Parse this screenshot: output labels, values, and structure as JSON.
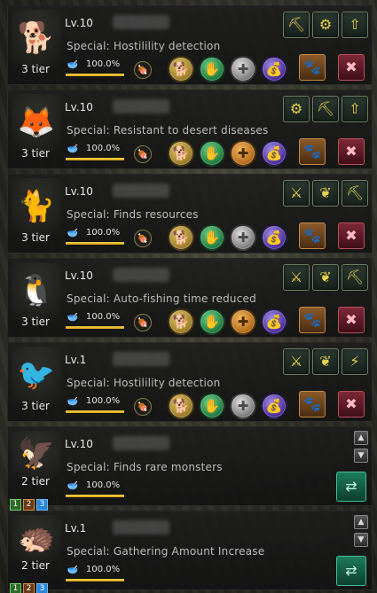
{
  "pets": [
    {
      "level": "Lv.10",
      "special": "Special: Hostilility detection",
      "tier": "3 tier",
      "hunger": "100.0%",
      "hunger_fraction": 1.0,
      "animal": "🐕",
      "skills": [
        "⛏",
        "⚙",
        "⇧"
      ],
      "variant": "active"
    },
    {
      "level": "Lv.10",
      "special": "Special: Resistant to desert diseases",
      "tier": "3 tier",
      "hunger": "100.0%",
      "hunger_fraction": 1.0,
      "animal": "🦊",
      "skills": [
        "⚙",
        "⛏",
        "⇧"
      ],
      "variant": "active"
    },
    {
      "level": "Lv.10",
      "special": "Special: Finds resources",
      "tier": "3 tier",
      "hunger": "100.0%",
      "hunger_fraction": 1.0,
      "animal": "🐈",
      "skills": [
        "⚔",
        "❦",
        "⛏"
      ],
      "variant": "active"
    },
    {
      "level": "Lv.10",
      "special": "Special: Auto-fishing time reduced",
      "tier": "3 tier",
      "hunger": "100.0%",
      "hunger_fraction": 1.0,
      "animal": "🐧",
      "skills": [
        "⚔",
        "❦",
        "⛏"
      ],
      "variant": "active"
    },
    {
      "level": "Lv.1",
      "special": "Special: Hostilility detection",
      "tier": "3 tier",
      "hunger": "100.0%",
      "hunger_fraction": 1.0,
      "animal": "🐦",
      "skills": [
        "⚔",
        "❦",
        "⚡"
      ],
      "variant": "active"
    },
    {
      "level": "Lv.10",
      "special": "Special: Finds rare monsters",
      "tier": "2 tier",
      "hunger": "100.0%",
      "hunger_fraction": 1.0,
      "animal": "🦅",
      "variant": "storage",
      "tier_nums": [
        "1",
        "2",
        "3"
      ],
      "active_num": 3
    },
    {
      "level": "Lv.1",
      "special": "Special: Gathering Amount Increase",
      "tier": "2 tier",
      "hunger": "100.0%",
      "hunger_fraction": 1.0,
      "animal": "🦔",
      "variant": "storage",
      "tier_nums": [
        "1",
        "2",
        "3"
      ],
      "active_num": 3
    }
  ],
  "icons": {
    "bowl": "🥣",
    "food_btn": "🍖",
    "command_circles": [
      "🐕",
      "✋",
      "✚",
      "💰"
    ],
    "paw": "🐾",
    "gift": "✖",
    "swap": "⇄",
    "up": "▲",
    "down": "▼"
  },
  "colors": {
    "hunger_bar": "#e6b822",
    "accent_swap": "#1f7a5c",
    "gift": "#7e2838"
  }
}
